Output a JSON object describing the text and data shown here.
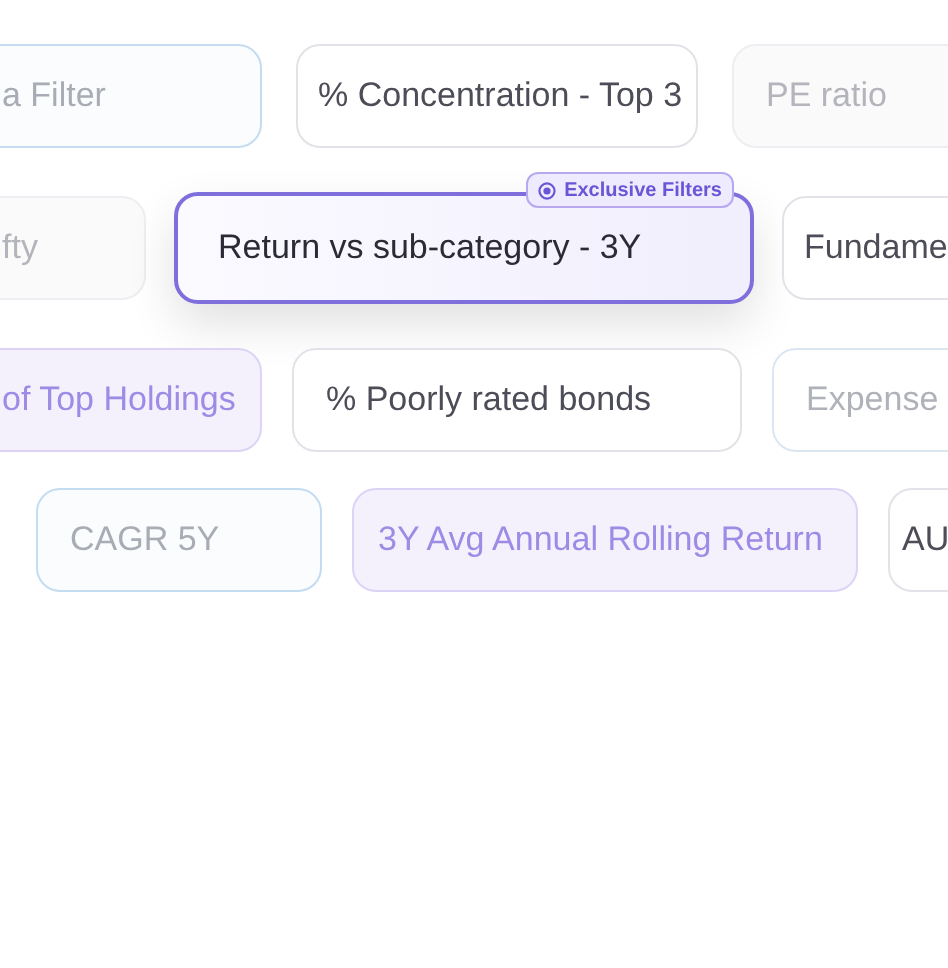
{
  "rows": [
    {
      "chips": [
        {
          "label": "a Filter",
          "kind": "outline"
        },
        {
          "label": "% Concentration - Top 3",
          "kind": "plain"
        },
        {
          "label": "PE ratio",
          "kind": "faded"
        }
      ]
    },
    {
      "chips": [
        {
          "label": "fty",
          "kind": "faded"
        },
        {
          "label": "Return vs sub-category - 3Y",
          "kind": "featured",
          "badge": "Exclusive Filters"
        },
        {
          "label": "Fundame",
          "kind": "plain"
        }
      ]
    },
    {
      "chips": [
        {
          "label": "of Top Holdings",
          "kind": "violet"
        },
        {
          "label": "% Poorly rated bonds",
          "kind": "plain"
        },
        {
          "label": "Expense",
          "kind": "faded-outline"
        }
      ]
    },
    {
      "chips": [
        {
          "label": "CAGR 5Y",
          "kind": "outline"
        },
        {
          "label": "3Y Avg Annual Rolling Return",
          "kind": "violet"
        },
        {
          "label": "AU",
          "kind": "plain"
        }
      ]
    }
  ]
}
